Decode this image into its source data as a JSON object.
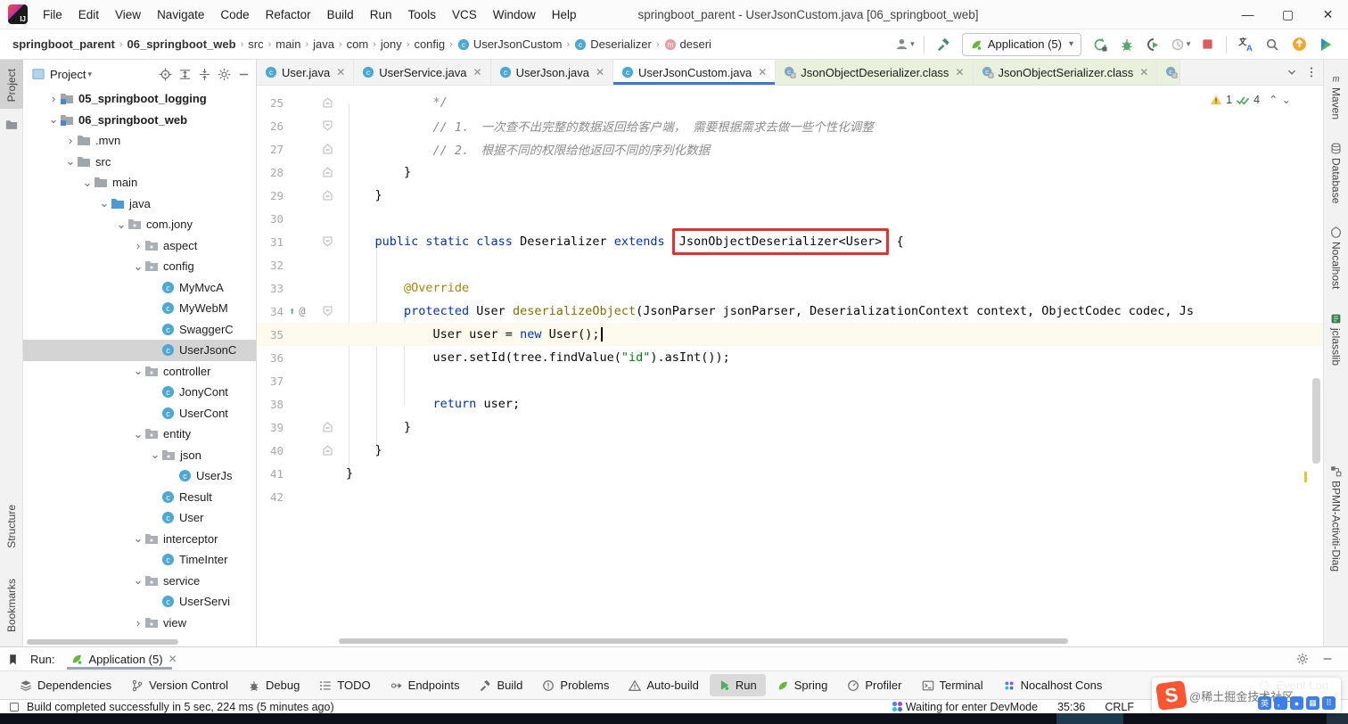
{
  "window": {
    "title": "springboot_parent - UserJsonCustom.java [06_springboot_web]",
    "menu": [
      "File",
      "Edit",
      "View",
      "Navigate",
      "Code",
      "Refactor",
      "Build",
      "Run",
      "Tools",
      "VCS",
      "Window",
      "Help"
    ],
    "controls": [
      "minimize",
      "maximize",
      "close"
    ]
  },
  "navbar": {
    "breadcrumbs": [
      {
        "label": "springboot_parent",
        "bold": true
      },
      {
        "label": "06_springboot_web",
        "bold": true
      },
      {
        "label": "src"
      },
      {
        "label": "main"
      },
      {
        "label": "java"
      },
      {
        "label": "com"
      },
      {
        "label": "jony"
      },
      {
        "label": "config"
      },
      {
        "label": "UserJsonCustom",
        "icon": "class"
      },
      {
        "label": "Deserializer",
        "icon": "class"
      },
      {
        "label": "deseri",
        "icon": "method"
      }
    ],
    "run_config": "Application (5)"
  },
  "tabs": [
    {
      "label": "User.java",
      "kind": "java"
    },
    {
      "label": "UserService.java",
      "kind": "java"
    },
    {
      "label": "UserJson.java",
      "kind": "java"
    },
    {
      "label": "UserJsonCustom.java",
      "kind": "java",
      "active": true
    },
    {
      "label": "JsonObjectDeserializer.class",
      "kind": "class"
    },
    {
      "label": "JsonObjectSerializer.class",
      "kind": "class"
    }
  ],
  "left_strip": {
    "project_label": "Project",
    "structure_label": "Structure",
    "bookmarks_label": "Bookmarks"
  },
  "right_strip": [
    {
      "label": "Maven",
      "icon": "maven"
    },
    {
      "label": "Database",
      "icon": "database"
    },
    {
      "label": "Nocalhost",
      "icon": "nocalhost"
    },
    {
      "label": "jclasslib",
      "icon": "jclasslib"
    },
    {
      "label": "BPMN-Activiti-Diag",
      "icon": "bpmn"
    }
  ],
  "project_panel": {
    "title": "Project",
    "tree": [
      {
        "d": 1,
        "arrow": ">",
        "icon": "module",
        "label": "05_springboot_logging",
        "bold": true
      },
      {
        "d": 1,
        "arrow": "v",
        "icon": "module",
        "label": "06_springboot_web",
        "bold": true
      },
      {
        "d": 2,
        "arrow": ">",
        "icon": "folder",
        "label": ".mvn"
      },
      {
        "d": 2,
        "arrow": "v",
        "icon": "folder",
        "label": "src"
      },
      {
        "d": 3,
        "arrow": "v",
        "icon": "folder",
        "label": "main"
      },
      {
        "d": 4,
        "arrow": "v",
        "icon": "folder-blue",
        "label": "java"
      },
      {
        "d": 5,
        "arrow": "v",
        "icon": "package",
        "label": "com.jony"
      },
      {
        "d": 6,
        "arrow": ">",
        "icon": "package",
        "label": "aspect"
      },
      {
        "d": 6,
        "arrow": "v",
        "icon": "package",
        "label": "config"
      },
      {
        "d": 7,
        "arrow": "",
        "icon": "class",
        "label": "MyMvcA"
      },
      {
        "d": 7,
        "arrow": "",
        "icon": "class",
        "label": "MyWebM"
      },
      {
        "d": 7,
        "arrow": "",
        "icon": "class",
        "label": "SwaggerC"
      },
      {
        "d": 7,
        "arrow": "",
        "icon": "class",
        "label": "UserJsonC",
        "selected": true
      },
      {
        "d": 6,
        "arrow": "v",
        "icon": "package",
        "label": "controller"
      },
      {
        "d": 7,
        "arrow": "",
        "icon": "class",
        "label": "JonyCont"
      },
      {
        "d": 7,
        "arrow": "",
        "icon": "class",
        "label": "UserCont"
      },
      {
        "d": 6,
        "arrow": "v",
        "icon": "package",
        "label": "entity"
      },
      {
        "d": 7,
        "arrow": "v",
        "icon": "package",
        "label": "json"
      },
      {
        "d": 8,
        "arrow": "",
        "icon": "class",
        "label": "UserJs"
      },
      {
        "d": 7,
        "arrow": "",
        "icon": "class",
        "label": "Result"
      },
      {
        "d": 7,
        "arrow": "",
        "icon": "class",
        "label": "User"
      },
      {
        "d": 6,
        "arrow": "v",
        "icon": "package",
        "label": "interceptor"
      },
      {
        "d": 7,
        "arrow": "",
        "icon": "class",
        "label": "TimeInter"
      },
      {
        "d": 6,
        "arrow": "v",
        "icon": "package",
        "label": "service"
      },
      {
        "d": 7,
        "arrow": "",
        "icon": "class",
        "label": "UserServi"
      },
      {
        "d": 6,
        "arrow": ">",
        "icon": "package",
        "label": "view"
      }
    ]
  },
  "editor": {
    "inspection": {
      "warnings": "1",
      "passed": "4"
    },
    "lines": [
      {
        "num": "25",
        "ind": 12,
        "fold": "up",
        "seg": [
          [
            "c",
            "*/"
          ]
        ]
      },
      {
        "num": "26",
        "ind": 12,
        "fold": "down",
        "seg": [
          [
            "c",
            "// 1． 一次查不出完整的数据返回给客户端， 需要根据需求去做一些个性化调整"
          ]
        ]
      },
      {
        "num": "27",
        "ind": 12,
        "fold": "up",
        "seg": [
          [
            "c",
            "// 2． 根据不同的权限给他返回不同的序列化数据"
          ]
        ]
      },
      {
        "num": "28",
        "ind": 8,
        "fold": "up",
        "seg": [
          [
            "p",
            "}"
          ]
        ]
      },
      {
        "num": "29",
        "ind": 4,
        "fold": "up",
        "seg": [
          [
            "p",
            "}"
          ]
        ]
      },
      {
        "num": "30",
        "ind": 0,
        "seg": []
      },
      {
        "num": "31",
        "ind": 4,
        "fold": "down",
        "seg": [
          [
            "k",
            "public static class "
          ],
          [
            "p",
            "Deserializer "
          ],
          [
            "k",
            "extends "
          ],
          [
            "box",
            "JsonObjectDeserializer<User>"
          ],
          [
            "p",
            " {"
          ]
        ]
      },
      {
        "num": "32",
        "ind": 0,
        "seg": []
      },
      {
        "num": "33",
        "ind": 8,
        "seg": [
          [
            "a",
            "@Override"
          ]
        ]
      },
      {
        "num": "34",
        "ind": 8,
        "fold": "down",
        "over": true,
        "seg": [
          [
            "k",
            "protected "
          ],
          [
            "p",
            "User "
          ],
          [
            "m",
            "deserializeObject"
          ],
          [
            "p",
            "(JsonParser jsonParser, DeserializationContext context, ObjectCodec codec, Js"
          ]
        ]
      },
      {
        "num": "35",
        "ind": 12,
        "cur": true,
        "caret": true,
        "seg": [
          [
            "p",
            "User user = "
          ],
          [
            "k",
            "new "
          ],
          [
            "p",
            "User();"
          ]
        ]
      },
      {
        "num": "36",
        "ind": 12,
        "seg": [
          [
            "p",
            "user.setId(tree.findValue("
          ],
          [
            "s",
            "\"id\""
          ],
          [
            "p",
            ").asInt());"
          ]
        ]
      },
      {
        "num": "37",
        "ind": 0,
        "seg": []
      },
      {
        "num": "38",
        "ind": 12,
        "seg": [
          [
            "k",
            "return "
          ],
          [
            "p",
            "user;"
          ]
        ]
      },
      {
        "num": "39",
        "ind": 8,
        "fold": "up",
        "seg": [
          [
            "p",
            "}"
          ]
        ]
      },
      {
        "num": "40",
        "ind": 4,
        "fold": "up",
        "seg": [
          [
            "p",
            "}"
          ]
        ]
      },
      {
        "num": "41",
        "ind": 0,
        "seg": [
          [
            "p",
            "}"
          ]
        ]
      },
      {
        "num": "42",
        "ind": 0,
        "seg": []
      }
    ]
  },
  "run_panel": {
    "label": "Run:",
    "tab_label": "Application (5)"
  },
  "toolwindow_bar": [
    {
      "label": "Dependencies",
      "icon": "layers"
    },
    {
      "label": "Version Control",
      "icon": "branch"
    },
    {
      "label": "Debug",
      "icon": "bug"
    },
    {
      "label": "TODO",
      "icon": "todo"
    },
    {
      "label": "Endpoints",
      "icon": "endpoints"
    },
    {
      "label": "Build",
      "icon": "hammer"
    },
    {
      "label": "Problems",
      "icon": "problem"
    },
    {
      "label": "Auto-build",
      "icon": "warntri"
    },
    {
      "label": "Run",
      "icon": "play",
      "active": true
    },
    {
      "label": "Spring",
      "icon": "leaf"
    },
    {
      "label": "Profiler",
      "icon": "gauge"
    },
    {
      "label": "Terminal",
      "icon": "terminal"
    },
    {
      "label": "Nocalhost Cons",
      "icon": "pinwheel"
    },
    {
      "label": "Event Log",
      "icon": "circle",
      "last": true
    }
  ],
  "status_bar": {
    "message": "Build completed successfully in 5 sec, 224 ms (5 minutes ago)",
    "devmode": "Waiting for enter DevMode",
    "caret_pos": "35:36",
    "line_separator": "CRLF"
  },
  "watermark": {
    "logo": "S",
    "text": "@稀土掘金技术社区"
  },
  "colors": {
    "accent_blue": "#3e78c9",
    "keyword": "#0033b3",
    "string": "#067d17",
    "comment": "#8c8c8c",
    "annotation": "#9e880d",
    "red_box": "#e3312d",
    "warning_yellow": "#f2c55c",
    "ok_green": "#59a869",
    "class_icon": "#4fa7d4",
    "method_icon": "#e8a0a6",
    "class_tab_bg": "#e9f0dc",
    "spring_green": "#6db33f"
  }
}
